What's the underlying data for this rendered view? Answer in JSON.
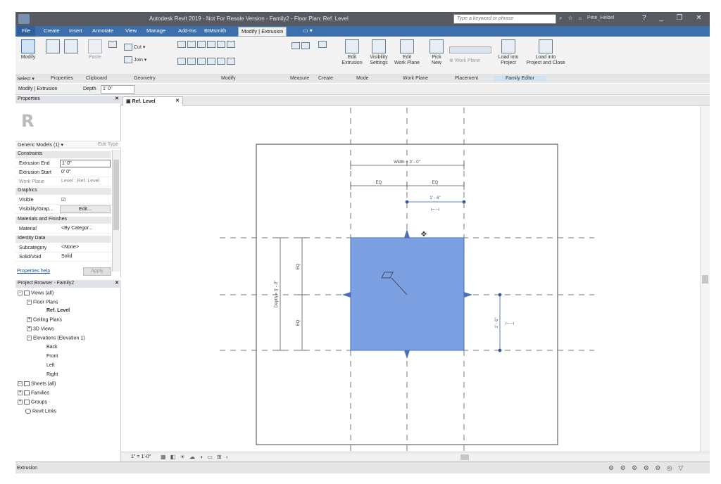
{
  "window": {
    "title": "Autodesk Revit 2019 - Not For Resale Version - Family2 - Floor Plan: Ref. Level",
    "search_placeholder": "Type a keyword or phrase",
    "user": "Pete_Heibel"
  },
  "ribbon_tabs": [
    "File",
    "Create",
    "Insert",
    "Annotate",
    "View",
    "Manage",
    "Add-Ins",
    "BIMsmith",
    "Modify | Extrusion"
  ],
  "ribbon": {
    "modify": "Modify",
    "paste": "Paste",
    "cut": "Cut",
    "join": "Join",
    "edit_extrusion": "Edit\nExtrusion",
    "edit_extrusion_l1": "Edit",
    "edit_extrusion_l2": "Extrusion",
    "visibility_l1": "Visibility",
    "visibility_l2": "Settings",
    "edit_wp_l1": "Edit",
    "edit_wp_l2": "Work Plane",
    "pick_l1": "Pick",
    "pick_l2": "New",
    "work_plane_btn": "Work Plane",
    "load_project_l1": "Load into",
    "load_project_l2": "Project",
    "load_close_l1": "Load into",
    "load_close_l2": "Project and Close"
  },
  "panels": [
    "Select ▾",
    "Properties",
    "Clipboard",
    "Geometry",
    "Modify",
    "Measure",
    "Create",
    "Mode",
    "Work Plane",
    "Placement",
    "Family Editor"
  ],
  "options_bar": {
    "context": "Modify | Extrusion",
    "depth_label": "Depth",
    "depth_value": "1'  0\""
  },
  "properties": {
    "title": "Properties",
    "type_selector": "Generic Models (1)",
    "edit_type": "Edit Type",
    "categories": {
      "constraints": "Constraints",
      "graphics": "Graphics",
      "materials": "Materials and Finishes",
      "identity": "Identity Data"
    },
    "rows": {
      "extrusion_end": {
        "k": "Extrusion End",
        "v": "1'  0\""
      },
      "extrusion_start": {
        "k": "Extrusion Start",
        "v": "0'  0\""
      },
      "work_plane": {
        "k": "Work Plane",
        "v": "Level : Ref. Level"
      },
      "visible": {
        "k": "Visible",
        "v": "☑"
      },
      "visibility_graphics": {
        "k": "Visibility/Grap...",
        "v": "Edit..."
      },
      "material": {
        "k": "Material",
        "v": "<By Categor..."
      },
      "subcategory": {
        "k": "Subcategory",
        "v": "<None>"
      },
      "solid_void": {
        "k": "Solid/Void",
        "v": "Solid"
      }
    },
    "help": "Properties help",
    "apply": "Apply"
  },
  "browser": {
    "title": "Project Browser - Family2",
    "nodes": {
      "views": "Views (all)",
      "floor_plans": "Floor Plans",
      "ref_level": "Ref. Level",
      "ceiling_plans": "Ceiling Plans",
      "views_3d": "3D Views",
      "elevations": "Elevations (Elevation 1)",
      "back": "Back",
      "front": "Front",
      "left": "Left",
      "right": "Right",
      "sheets": "Sheets (all)",
      "families": "Families",
      "groups": "Groups",
      "links": "Revit Links"
    }
  },
  "view_tab": "Ref. Level",
  "drawing": {
    "width_dim": "Width = 3' - 0\"",
    "depth_dim": "Depth = 3' - 0\"",
    "eq": "EQ",
    "dim_1_6": "1' - 6\"",
    "extrusion_color": "#7b9fe0"
  },
  "view_control": {
    "scale": "1\" = 1'-0\""
  },
  "status": {
    "text": "Extrusion"
  }
}
